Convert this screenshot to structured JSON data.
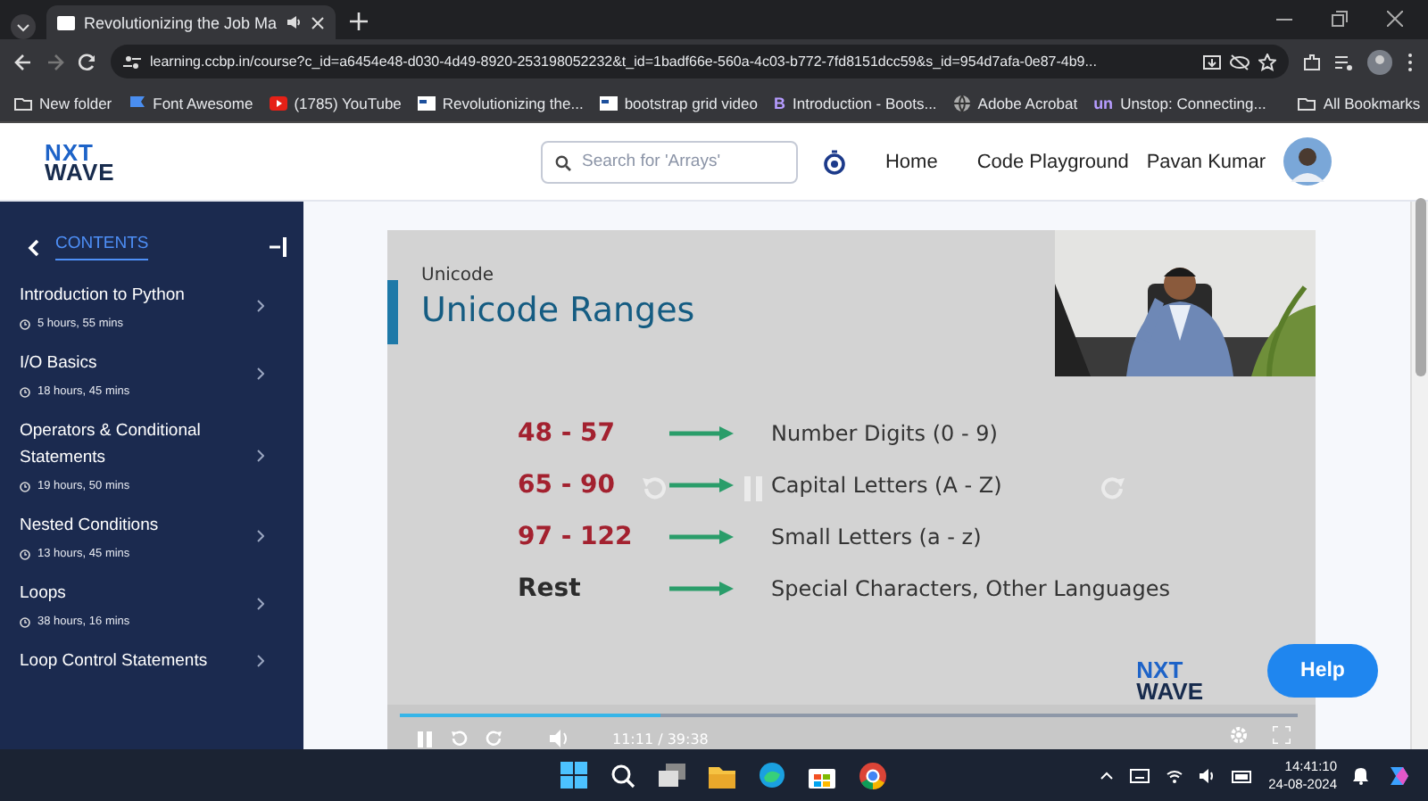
{
  "browser": {
    "tabs": [
      {
        "title": "Revolutionizing the Job Ma",
        "selected": true,
        "audio": true
      }
    ],
    "address": "learning.ccbp.in/course?c_id=a6454e48-d030-4d49-8920-253198052232&t_id=1badf66e-560a-4c03-b772-7fd8151dcc59&s_id=954d7afa-0e87-4b9...",
    "bookmarks": [
      {
        "label": "New folder",
        "kind": "folder"
      },
      {
        "label": "Font Awesome",
        "kind": "flag"
      },
      {
        "label": "(1785) YouTube",
        "kind": "video"
      },
      {
        "label": "Revolutionizing the...",
        "kind": "site"
      },
      {
        "label": "bootstrap grid video",
        "kind": "site"
      },
      {
        "label": "Introduction - Boots...",
        "kind": "letter",
        "letter": "B"
      },
      {
        "label": "Adobe Acrobat",
        "kind": "globe"
      },
      {
        "label": "Unstop: Connecting...",
        "kind": "letter",
        "letter": "un"
      }
    ],
    "all_bookmarks": "All Bookmarks"
  },
  "header": {
    "logo": [
      "NXT",
      "WAVE"
    ],
    "search": {
      "placeholder": "Search for 'Arrays'"
    },
    "nav": [
      "Home",
      "Code Playground"
    ],
    "user": "Pavan Kumar"
  },
  "sidebar": {
    "title": "CONTENTS",
    "items": [
      {
        "title": "Introduction to Python",
        "duration": "5 hours, 55 mins"
      },
      {
        "title": "I/O Basics",
        "duration": "18 hours, 45 mins"
      },
      {
        "title": "Operators & Conditional Statements",
        "duration": "19 hours, 50 mins"
      },
      {
        "title": "Nested Conditions",
        "duration": "13 hours, 45 mins"
      },
      {
        "title": "Loops",
        "duration": "38 hours, 16 mins"
      },
      {
        "title": "Loop Control Statements"
      }
    ]
  },
  "video": {
    "slide": {
      "section": "Unicode",
      "title": "Unicode Ranges",
      "rows": [
        {
          "range": "48 - 57",
          "color": "#a3212f",
          "description": "Number Digits (0 - 9)"
        },
        {
          "range": "65 - 90",
          "color": "#a3212f",
          "description": "Capital Letters (A - Z)"
        },
        {
          "range": "97 - 122",
          "color": "#a3212f",
          "description": "Small Letters (a - z)"
        },
        {
          "range": "Rest",
          "color": "#2b2b2b",
          "description": "Special Characters, Other Languages"
        }
      ],
      "logo": [
        "NXT",
        "WAVE"
      ]
    },
    "playing": true,
    "level": 0.29,
    "time": "11:11 / 39:38"
  },
  "help": "Help",
  "taskbar": {
    "time": "14:41:10",
    "date": "24-08-2024"
  }
}
